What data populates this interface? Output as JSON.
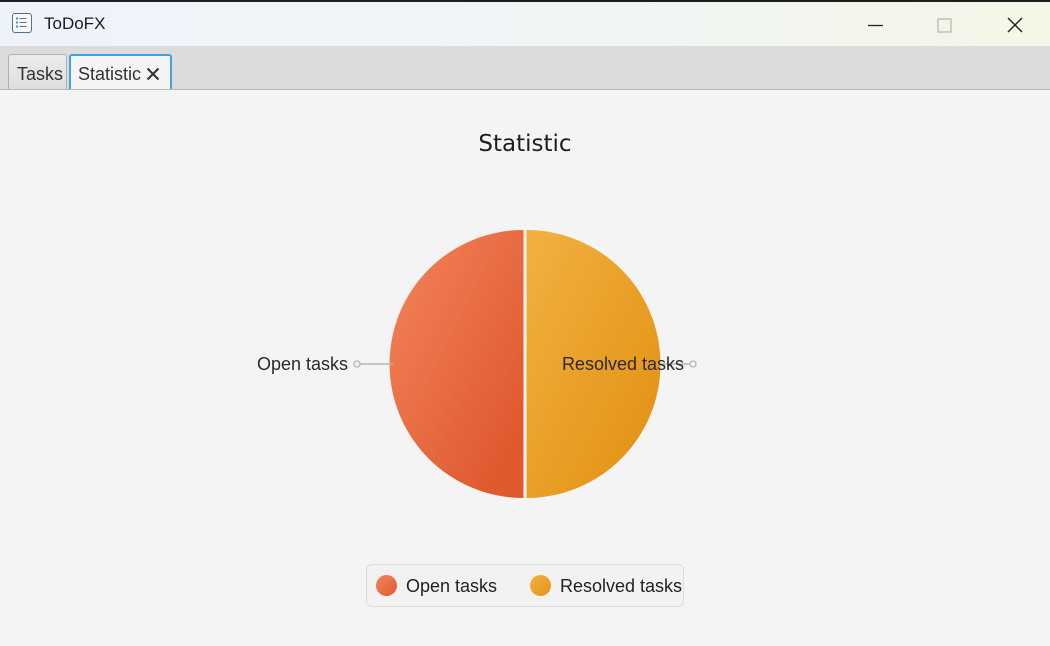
{
  "window": {
    "title": "ToDoFX",
    "app_icon": "checklist-icon",
    "controls": [
      "minimize-icon",
      "maximize-icon",
      "close-icon"
    ]
  },
  "tabs": [
    {
      "label": "Tasks",
      "selected": false
    },
    {
      "label": "Statistic",
      "selected": true,
      "closable": true
    }
  ],
  "colors": {
    "tab_focus": "#3ba6da",
    "open_tasks": "#e05a2f",
    "resolved_tasks": "#eaa028"
  },
  "chart_data": {
    "type": "pie",
    "title": "Statistic",
    "slices": [
      {
        "label": "Open tasks",
        "value": 50,
        "color": "#e05a2f",
        "color_light": "#f4845c"
      },
      {
        "label": "Resolved tasks",
        "value": 50,
        "color": "#e39417",
        "color_light": "#f2b140"
      }
    ],
    "legend": [
      "Open tasks",
      "Resolved tasks"
    ],
    "legend_position": "bottom"
  }
}
